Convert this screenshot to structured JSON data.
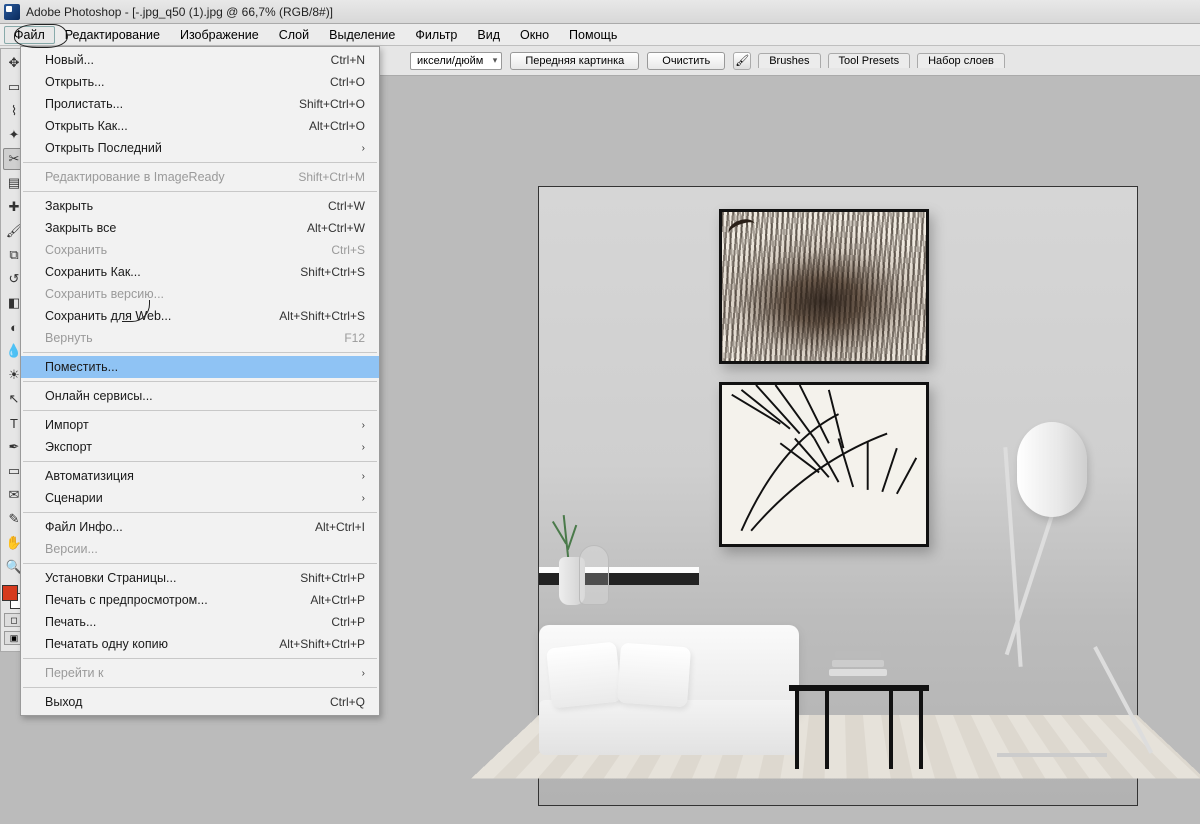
{
  "title": "Adobe Photoshop - [-.jpg_q50 (1).jpg @ 66,7% (RGB/8#)]",
  "menubar": {
    "file": "Файл",
    "edit": "Редактирование",
    "image": "Изображение",
    "layer": "Слой",
    "select": "Выделение",
    "filter": "Фильтр",
    "view": "Вид",
    "window": "Окно",
    "help": "Помощь"
  },
  "options": {
    "unit": "иксели/дюйм",
    "front": "Передняя картинка",
    "clear": "Очистить",
    "tab_brushes": "Brushes",
    "tab_presets": "Tool Presets",
    "tab_layers": "Набор слоев"
  },
  "file_menu": {
    "new": {
      "label": "Новый...",
      "sc": "Ctrl+N"
    },
    "open": {
      "label": "Открыть...",
      "sc": "Ctrl+O"
    },
    "browse": {
      "label": "Пролистать...",
      "sc": "Shift+Ctrl+O"
    },
    "open_as": {
      "label": "Открыть Как...",
      "sc": "Alt+Ctrl+O"
    },
    "open_recent": {
      "label": "Открыть Последний",
      "sub": "›"
    },
    "edit_ir": {
      "label": "Редактирование в ImageReady",
      "sc": "Shift+Ctrl+M"
    },
    "close": {
      "label": "Закрыть",
      "sc": "Ctrl+W"
    },
    "close_all": {
      "label": "Закрыть все",
      "sc": "Alt+Ctrl+W"
    },
    "save": {
      "label": "Сохранить",
      "sc": "Ctrl+S"
    },
    "save_as": {
      "label": "Сохранить Как...",
      "sc": "Shift+Ctrl+S"
    },
    "save_version": {
      "label": "Сохранить версию..."
    },
    "save_web": {
      "label": "Сохранить для Web...",
      "sc": "Alt+Shift+Ctrl+S"
    },
    "revert": {
      "label": "Вернуть",
      "sc": "F12"
    },
    "place": {
      "label": "Поместить..."
    },
    "online": {
      "label": "Онлайн сервисы..."
    },
    "import": {
      "label": "Импорт",
      "sub": "›"
    },
    "export": {
      "label": "Экспорт",
      "sub": "›"
    },
    "automate": {
      "label": "Автоматизиция",
      "sub": "›"
    },
    "scripts": {
      "label": "Сценарии",
      "sub": "›"
    },
    "file_info": {
      "label": "Файл Инфо...",
      "sc": "Alt+Ctrl+I"
    },
    "versions": {
      "label": "Версии..."
    },
    "page_setup": {
      "label": "Установки Страницы...",
      "sc": "Shift+Ctrl+P"
    },
    "print_preview": {
      "label": "Печать с предпросмотром...",
      "sc": "Alt+Ctrl+P"
    },
    "print": {
      "label": "Печать...",
      "sc": "Ctrl+P"
    },
    "print_one": {
      "label": "Печатать одну копию",
      "sc": "Alt+Shift+Ctrl+P"
    },
    "jump_to": {
      "label": "Перейти к",
      "sub": "›"
    },
    "exit": {
      "label": "Выход",
      "sc": "Ctrl+Q"
    }
  }
}
